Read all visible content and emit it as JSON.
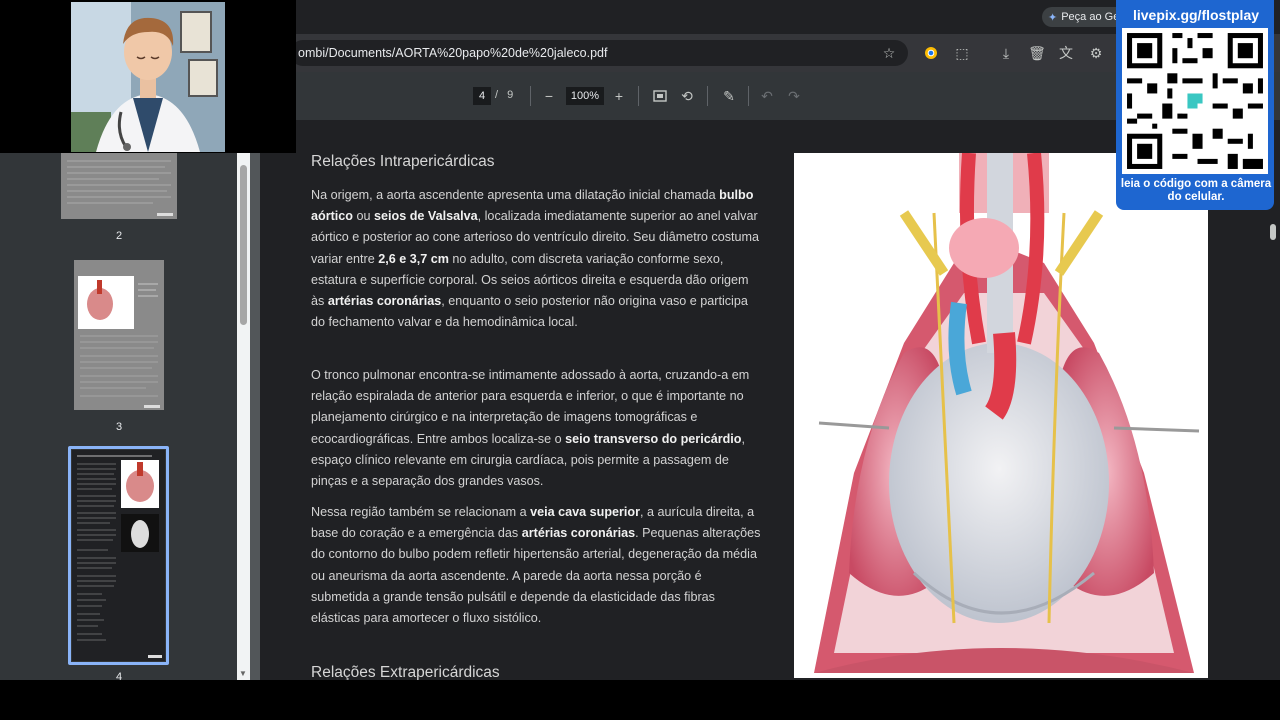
{
  "browser": {
    "url": "ombi/Documents/AORTA%20papo%20de%20jaleco.pdf",
    "gemini_chip": "Peça ao Ge",
    "icons": [
      "star-icon",
      "chrome-icon",
      "extensions-icon",
      "download-icon",
      "trash-icon",
      "translate-icon",
      "settings-icon"
    ]
  },
  "pdf_toolbar": {
    "page_current": "4",
    "page_separator": "/",
    "page_total": "9",
    "zoom": "100%",
    "icons": [
      "zoom-out-icon",
      "zoom-in-icon",
      "fit-page-icon",
      "rotate-icon",
      "annotate-icon",
      "undo-icon",
      "redo-icon"
    ]
  },
  "sidebar": {
    "thumbnails": [
      {
        "label": "2"
      },
      {
        "label": "3"
      },
      {
        "label": "4",
        "selected": true
      }
    ]
  },
  "document": {
    "heading1": "Relações Intrapericárdicas",
    "para1": [
      {
        "t": "Na origem, a aorta ascendente apresenta uma dilatação inicial chamada "
      },
      {
        "t": "bulbo aórtico",
        "b": true
      },
      {
        "t": " ou "
      },
      {
        "t": "seios de Valsalva",
        "b": true
      },
      {
        "t": ", localizada imediatamente superior ao anel valvar aórtico e posterior ao cone arterioso do ventrículo direito. Seu diâmetro costuma variar entre "
      },
      {
        "t": "2,6 e 3,7 cm",
        "b": true
      },
      {
        "t": " no adulto, com discreta variação conforme sexo, estatura e superfície corporal. Os seios aórticos direita e esquerda dão origem às "
      },
      {
        "t": "artérias coronárias",
        "b": true
      },
      {
        "t": ", enquanto o seio posterior não origina vaso e participa do fechamento valvar e da hemodinâmica local."
      }
    ],
    "para2": [
      {
        "t": "O tronco pulmonar encontra-se intimamente adossado à aorta, cruzando-a em relação espiralada de anterior para esquerda e inferior, o que é importante no planejamento cirúrgico e na interpretação de imagens tomográficas e ecocardiográficas. Entre ambos localiza-se o "
      },
      {
        "t": "seio transverso do pericárdio",
        "b": true
      },
      {
        "t": ", espaço clínico relevante em cirurgia cardíaca, pois permite a passagem de pinças e a separação dos grandes vasos."
      }
    ],
    "para3": [
      {
        "t": "Nessa região também se relacionam a "
      },
      {
        "t": "veia cava superior",
        "b": true
      },
      {
        "t": ", a aurícula direita, a base do coração e a emergência das "
      },
      {
        "t": "artérias coronárias",
        "b": true
      },
      {
        "t": ". Pequenas alterações do contorno do bulbo podem refletir hipertensão arterial, degeneração da média ou aneurisma da aorta ascendente. A parede da aorta nessa porção é submetida a grande tensão pulsátil e depende da elasticidade das fibras elásticas para amortecer o fluxo sistólico."
      }
    ],
    "heading2": "Relações Extrapericárdicas"
  },
  "overlay_qr": {
    "title": "livepix.gg/flostplay",
    "caption": "leia o código com a câmera do celular."
  },
  "colors": {
    "accent": "#1e66d0",
    "selected_thumb": "#8ab4f8"
  }
}
